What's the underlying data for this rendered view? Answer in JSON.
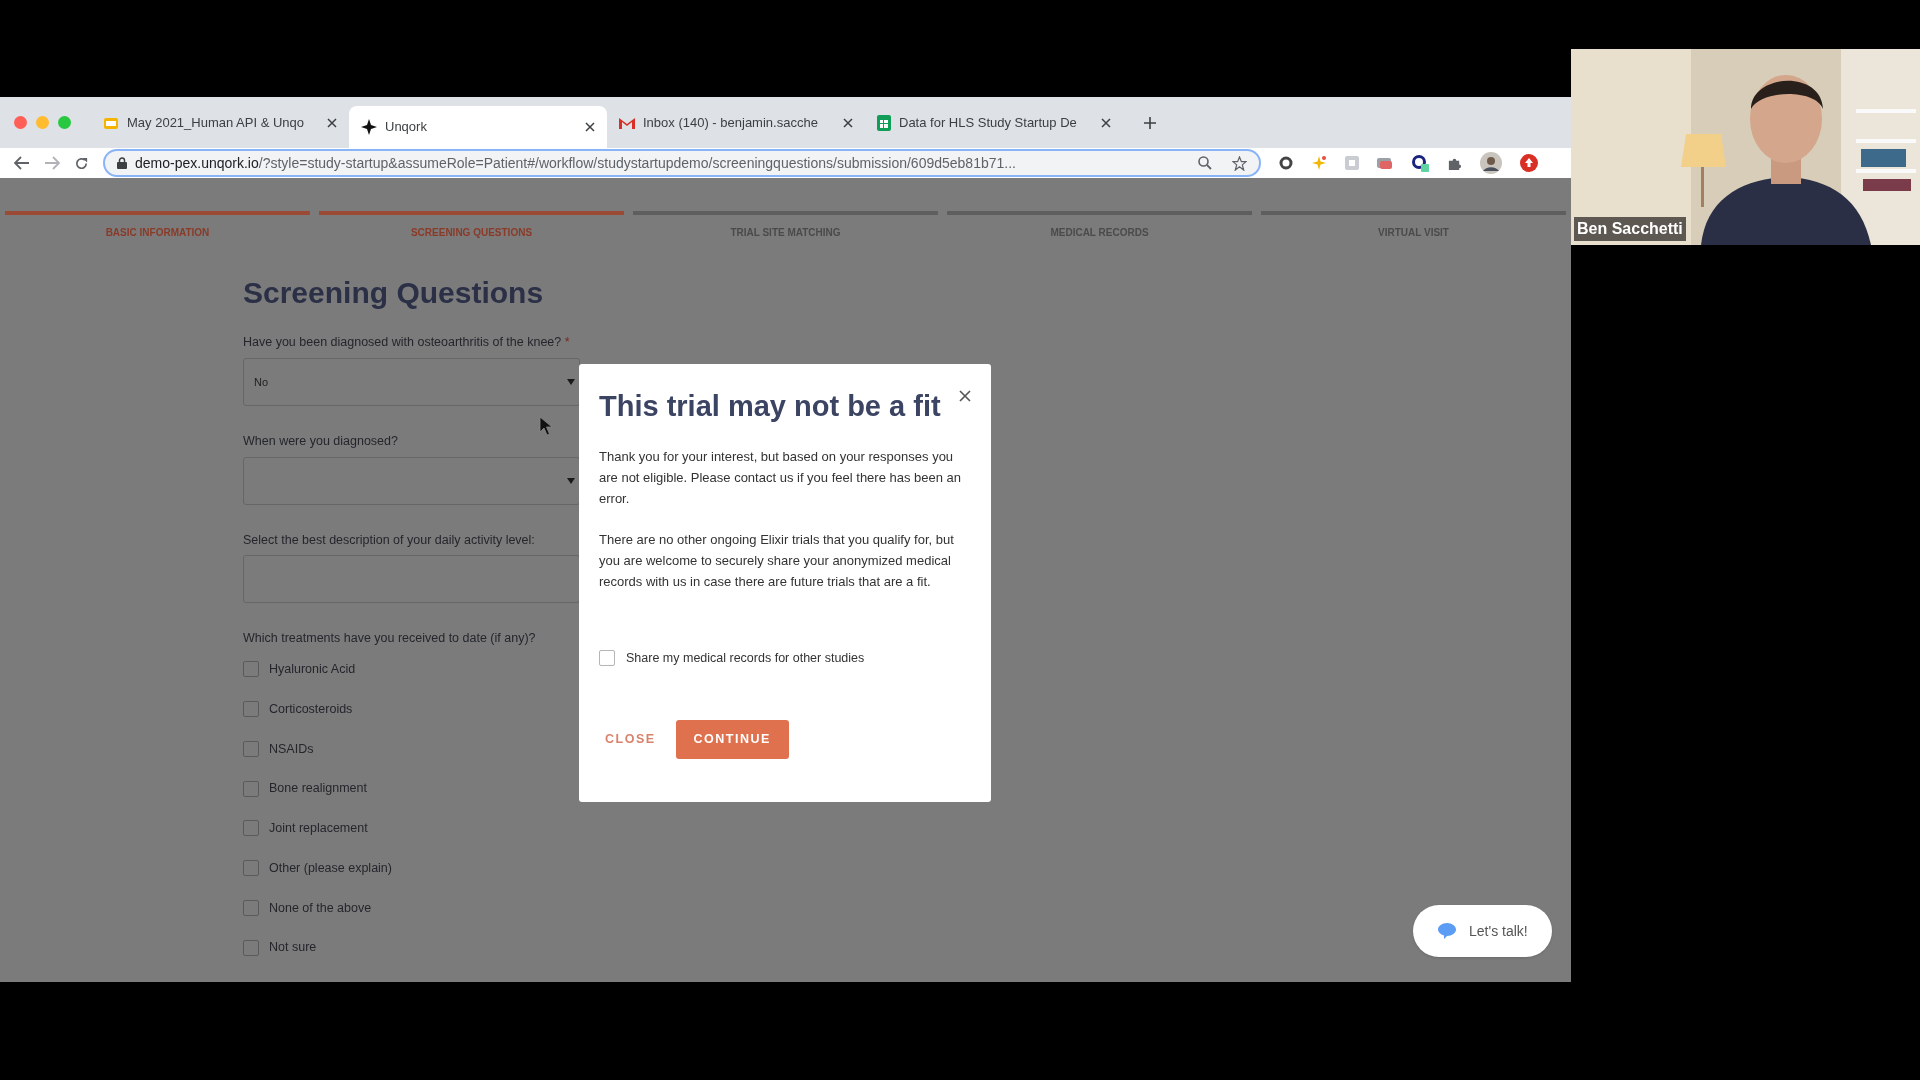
{
  "browser": {
    "tabs": [
      {
        "title": "May 2021_Human API & Unqo",
        "selected": false
      },
      {
        "title": "Unqork",
        "selected": true
      },
      {
        "title": "Inbox (140) - benjamin.sacche",
        "selected": false
      },
      {
        "title": "Data for HLS Study Startup De",
        "selected": false
      }
    ],
    "url_host": "demo-pex.unqork.io",
    "url_path": "/?style=study-startup&assumeRole=Patient#/workflow/studystartupdemo/screeningquestions/submission/609d5eb81b71..."
  },
  "steps": [
    {
      "label": "BASIC INFORMATION",
      "reached": true
    },
    {
      "label": "SCREENING QUESTIONS",
      "reached": true
    },
    {
      "label": "TRIAL SITE MATCHING",
      "reached": false
    },
    {
      "label": "MEDICAL RECORDS",
      "reached": false
    },
    {
      "label": "VIRTUAL VISIT",
      "reached": false
    }
  ],
  "heading": "Screening Questions",
  "questions": [
    {
      "kind": "select",
      "label": "Have you been diagnosed with osteoarthritis of the knee?",
      "marker": "*",
      "value": "No"
    },
    {
      "kind": "select",
      "label": "When were you diagnosed?"
    },
    {
      "kind": "text",
      "label": "Select the best description of your daily activity level:"
    }
  ],
  "treatments": {
    "label": "Which treatments have you received to date (if any)?",
    "options": [
      {
        "label": "Hyaluronic Acid",
        "checked": false
      },
      {
        "label": "Corticosteroids",
        "checked": false
      },
      {
        "label": "NSAIDs",
        "checked": false
      },
      {
        "label": "Bone realignment",
        "checked": false
      },
      {
        "label": "Joint replacement",
        "checked": false
      },
      {
        "label": "Other (please explain)",
        "checked": false
      },
      {
        "label": "None of the above",
        "checked": false
      },
      {
        "label": "Not sure",
        "checked": false
      }
    ]
  },
  "modal": {
    "title": "This trial may not be a fit",
    "paragraphs": [
      "Thank you for your interest, but based on your responses you are not eligible. Please contact us if you feel there has been an error.",
      "There are no other ongoing Elixir trials that you qualify for, but you are welcome to securely share your anonymized medical records with us in case there are future trials that are a fit."
    ],
    "checkbox": {
      "label": "Share my medical records for other studies",
      "checked": false
    },
    "close": "CLOSE",
    "continue": "CONTINUE"
  },
  "chat": {
    "label": "Let's talk!"
  },
  "video": {
    "name": "Ben Sacchetti"
  }
}
